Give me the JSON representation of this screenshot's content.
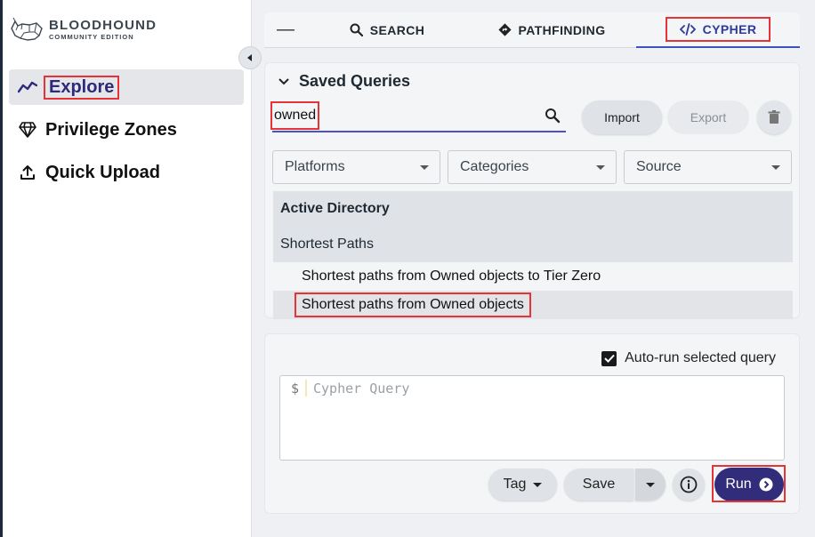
{
  "app": {
    "logo_main": "BLOODHOUND",
    "logo_sub": "COMMUNITY EDITION"
  },
  "sidebar": {
    "items": [
      {
        "label": "Explore",
        "icon": "line-chart-icon",
        "active": true
      },
      {
        "label": "Privilege Zones",
        "icon": "gem-icon",
        "active": false
      },
      {
        "label": "Quick Upload",
        "icon": "upload-icon",
        "active": false
      }
    ]
  },
  "tabs": {
    "collapse_symbol": "—",
    "items": [
      {
        "label": "SEARCH",
        "icon": "search-icon"
      },
      {
        "label": "PATHFINDING",
        "icon": "diamond-arrow-icon"
      },
      {
        "label": "CYPHER",
        "icon": "code-icon",
        "active": true
      }
    ]
  },
  "saved_queries": {
    "title": "Saved Queries",
    "search_value": "owned",
    "import_label": "Import",
    "export_label": "Export",
    "filters": {
      "platforms": "Platforms",
      "categories": "Categories",
      "source": "Source"
    },
    "platform_group": "Active Directory",
    "category_group": "Shortest Paths",
    "queries": [
      {
        "label": "Shortest paths from Owned objects to Tier Zero",
        "selected": false
      },
      {
        "label": "Shortest paths from Owned objects",
        "selected": true
      }
    ]
  },
  "editor": {
    "autorun_label": "Auto-run selected query",
    "autorun_checked": true,
    "prompt_symbol": "$",
    "placeholder": "Cypher Query",
    "tag_label": "Tag",
    "save_label": "Save",
    "run_label": "Run"
  },
  "colors": {
    "accent": "#322d7a",
    "tab_active": "#2d3a9c",
    "highlight": "#e53338"
  }
}
